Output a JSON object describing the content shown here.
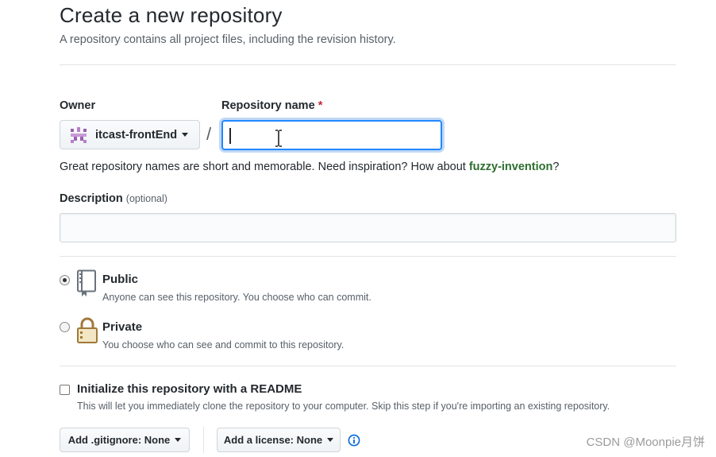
{
  "header": {
    "title": "Create a new repository",
    "subtitle": "A repository contains all project files, including the revision history."
  },
  "owner": {
    "label": "Owner",
    "value": "itcast-frontEnd",
    "avatar_icon": "org-avatar-icon"
  },
  "repo_name": {
    "label": "Repository name",
    "required_mark": "*",
    "value": "",
    "separator": "/"
  },
  "hint": {
    "text": "Great repository names are short and memorable. Need inspiration? How about ",
    "suggestion": "fuzzy-invention",
    "end": "?"
  },
  "description": {
    "label": "Description",
    "optional": "(optional)",
    "value": ""
  },
  "visibility": {
    "public": {
      "title": "Public",
      "note": "Anyone can see this repository. You choose who can commit.",
      "checked": true,
      "icon": "repo-book-icon"
    },
    "private": {
      "title": "Private",
      "note": "You choose who can see and commit to this repository.",
      "checked": false,
      "icon": "lock-icon"
    }
  },
  "readme": {
    "title": "Initialize this repository with a README",
    "note": "This will let you immediately clone the repository to your computer. Skip this step if you're importing an existing repository.",
    "checked": false
  },
  "buttons": {
    "gitignore": "Add .gitignore: None",
    "license": "Add a license: None"
  },
  "watermark": "CSDN @Moonpie月饼",
  "colors": {
    "focus": "#2188ff",
    "suggestion": "#2c6e2f",
    "required": "#cb2431",
    "info": "#0366d6"
  }
}
